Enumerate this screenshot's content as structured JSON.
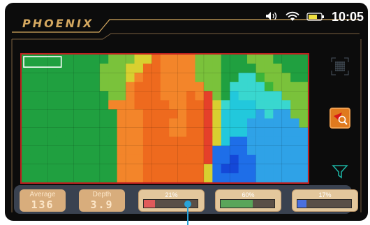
{
  "app": {
    "brand": "PHOENIX"
  },
  "status_bar": {
    "time": "10:05",
    "icons": [
      "volume-icon",
      "wifi-icon",
      "battery-icon"
    ]
  },
  "colors": {
    "frame": "#d4a860",
    "heatmap_border": "#c02020",
    "marker": "#29a3d8",
    "bar_track": "#5a4f47"
  },
  "heatmap": {
    "palette": {
      "g": "#20a040",
      "G": "#3bb53a",
      "l": "#7ac23b",
      "y": "#d8d030",
      "o": "#ee6a1e",
      "O": "#f3852a",
      "r": "#e5402a",
      "c": "#22c8dc",
      "C": "#39d7cf",
      "b": "#2fa2e7",
      "B": "#1e6ee8",
      "d": "#1448d8"
    },
    "rows": [
      "gggggggggglllyyoOOOOlllggglllgggg",
      "ggggggggglllyyooOOOOlllgggglllggg",
      "ggggggggglllyOooOOOOlllggCCGlllgg",
      "ggggggggglllOoooOOOOOllgCCCCGllll",
      "ggggggggggllOoooOOOoOrlgcCCCCClll",
      "ggggggggggOOOooooOOooryCcccCCCCll",
      "gggggggggggOOOooooOooryccccbCbbll",
      "gggggggggggOOOoooOOoorycccbbbbbbl",
      "gggggggggggOOOoooOOoorycccbbbbbbb",
      "gggggggggggOOOooooooorycBBbbbbbbb",
      "gggggggggggOOOooooooorBBBBbbbbbbb",
      "gggggggggggOOOooooooorBBdBBbbbbbb",
      "gggggggggggOOOoooooooyBddBBbbbbbb",
      "gggggggggggOOOoooooooyBBBBBbbbbbb"
    ],
    "selection": {
      "row": 0,
      "col_start": 0,
      "col_end": 3
    }
  },
  "side_tools": [
    {
      "name": "grid-view-icon",
      "active": false
    },
    {
      "name": "target-zoom-icon",
      "active": true
    },
    {
      "name": "filter-icon",
      "active": false
    }
  ],
  "readouts": {
    "average": {
      "label": "Average",
      "value": "136"
    },
    "depth": {
      "label": "Depth",
      "value": "3.9"
    }
  },
  "bars": [
    {
      "label": "21%",
      "fill": 0.21,
      "color": "#e05a5a"
    },
    {
      "label": "60%",
      "fill": 0.6,
      "color": "#5aa55a"
    },
    {
      "label": "17%",
      "fill": 0.17,
      "color": "#4a70e0"
    }
  ]
}
